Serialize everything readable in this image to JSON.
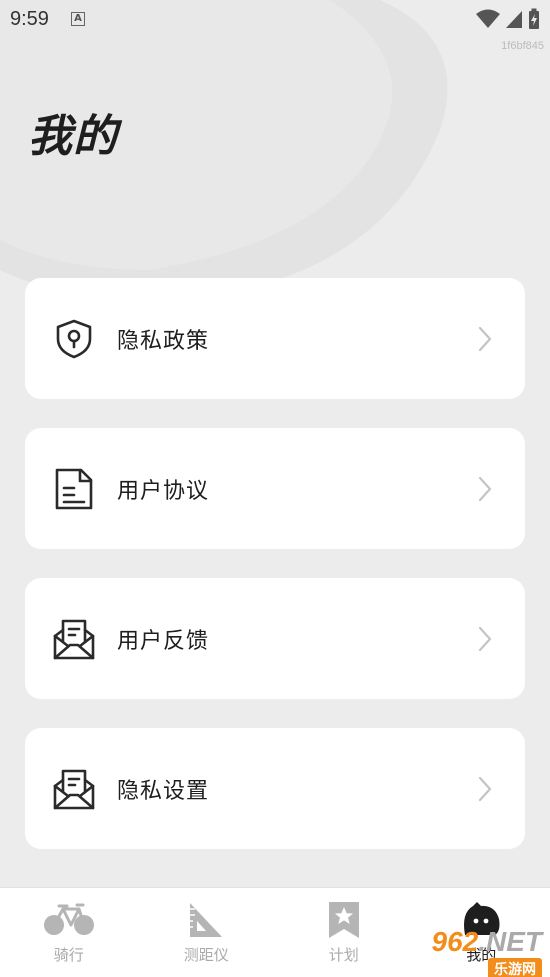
{
  "status_bar": {
    "time": "9:59",
    "notif_glyph": "A"
  },
  "build_id": "1f6bf845",
  "page_title": "我的",
  "menu": [
    {
      "label": "隐私政策",
      "icon": "shield-lock-icon"
    },
    {
      "label": "用户协议",
      "icon": "document-icon"
    },
    {
      "label": "用户反馈",
      "icon": "mail-open-icon"
    },
    {
      "label": "隐私设置",
      "icon": "mail-open-icon"
    }
  ],
  "tabs": [
    {
      "label": "骑行",
      "icon": "bicycle-icon"
    },
    {
      "label": "测距仪",
      "icon": "ruler-triangle-icon"
    },
    {
      "label": "计划",
      "icon": "bookmark-star-icon"
    },
    {
      "label": "我的",
      "icon": "profile-face-icon"
    }
  ],
  "watermark": {
    "number": "962",
    "suffix": ".NET",
    "site": "乐游网"
  }
}
